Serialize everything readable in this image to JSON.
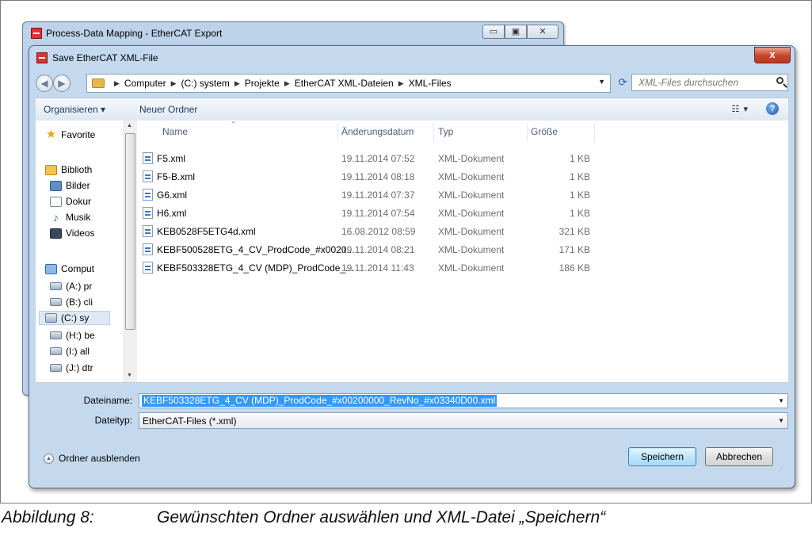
{
  "parent_window": {
    "title": "Process-Data Mapping - EtherCAT Export",
    "controls": [
      "▭",
      "▣",
      "✕"
    ]
  },
  "dialog": {
    "title": "Save EtherCAT XML-File",
    "close_label": "x"
  },
  "address_bar": {
    "back": "◀",
    "forward": "▶",
    "breadcrumbs": [
      "Computer",
      "(C:) system",
      "Projekte",
      "EtherCAT XML-Dateien",
      "XML-Files"
    ],
    "search_placeholder": "XML-Files durchsuchen"
  },
  "toolbar": {
    "organize": "Organisieren ▾",
    "new_folder": "Neuer Ordner",
    "view": "☷ ▾",
    "help": "?"
  },
  "navigation": {
    "items": [
      {
        "label": "Favorite",
        "icon": "star"
      },
      {
        "label": "Biblioth",
        "icon": "lib"
      },
      {
        "label": "Bilder",
        "icon": "pic"
      },
      {
        "label": "Dokur",
        "icon": "doc"
      },
      {
        "label": "Musik",
        "icon": "music"
      },
      {
        "label": "Videos",
        "icon": "video"
      },
      {
        "label": "Comput",
        "icon": "comp"
      },
      {
        "label": "(A:) pr",
        "icon": "drive"
      },
      {
        "label": "(B:) cli",
        "icon": "drive"
      },
      {
        "label": "(C:) sy",
        "icon": "cdrive"
      },
      {
        "label": "(H:) be",
        "icon": "drive"
      },
      {
        "label": "(I:) all",
        "icon": "drive"
      },
      {
        "label": "(J:) dtr",
        "icon": "drive"
      }
    ]
  },
  "file_list": {
    "columns": [
      "Name",
      "Änderungsdatum",
      "Typ",
      "Größe"
    ],
    "rows": [
      {
        "name": "F5.xml",
        "date": "19.11.2014 07:52",
        "type": "XML-Dokument",
        "size": "1 KB"
      },
      {
        "name": "F5-B.xml",
        "date": "19.11.2014 08:18",
        "type": "XML-Dokument",
        "size": "1 KB"
      },
      {
        "name": "G6.xml",
        "date": "19.11.2014 07:37",
        "type": "XML-Dokument",
        "size": "1 KB"
      },
      {
        "name": "H6.xml",
        "date": "19.11.2014 07:54",
        "type": "XML-Dokument",
        "size": "1 KB"
      },
      {
        "name": "KEB0528F5ETG4d.xml",
        "date": "16.08.2012 08:59",
        "type": "XML-Dokument",
        "size": "321 KB"
      },
      {
        "name": "KEBF500528ETG_4_CV_ProdCode_#x0020...",
        "date": "19.11.2014 08:21",
        "type": "XML-Dokument",
        "size": "171 KB"
      },
      {
        "name": "KEBF503328ETG_4_CV (MDP)_ProdCode_...",
        "date": "19.11.2014 11:43",
        "type": "XML-Dokument",
        "size": "186 KB"
      }
    ]
  },
  "save_form": {
    "filename_label": "Dateiname:",
    "filename_value": "KEBF503328ETG_4_CV (MDP)_ProdCode_#x00200000_RevNo_#x03340D00.xml",
    "filetype_label": "Dateityp:",
    "filetype_value": "EtherCAT-Files (*.xml)"
  },
  "footer": {
    "hide_folders": "Ordner ausblenden",
    "save": "Speichern",
    "cancel": "Abbrechen"
  },
  "caption": {
    "number": "Abbildung 8:",
    "text": "Gewünschten Ordner auswählen und XML-Datei „Speichern“"
  }
}
